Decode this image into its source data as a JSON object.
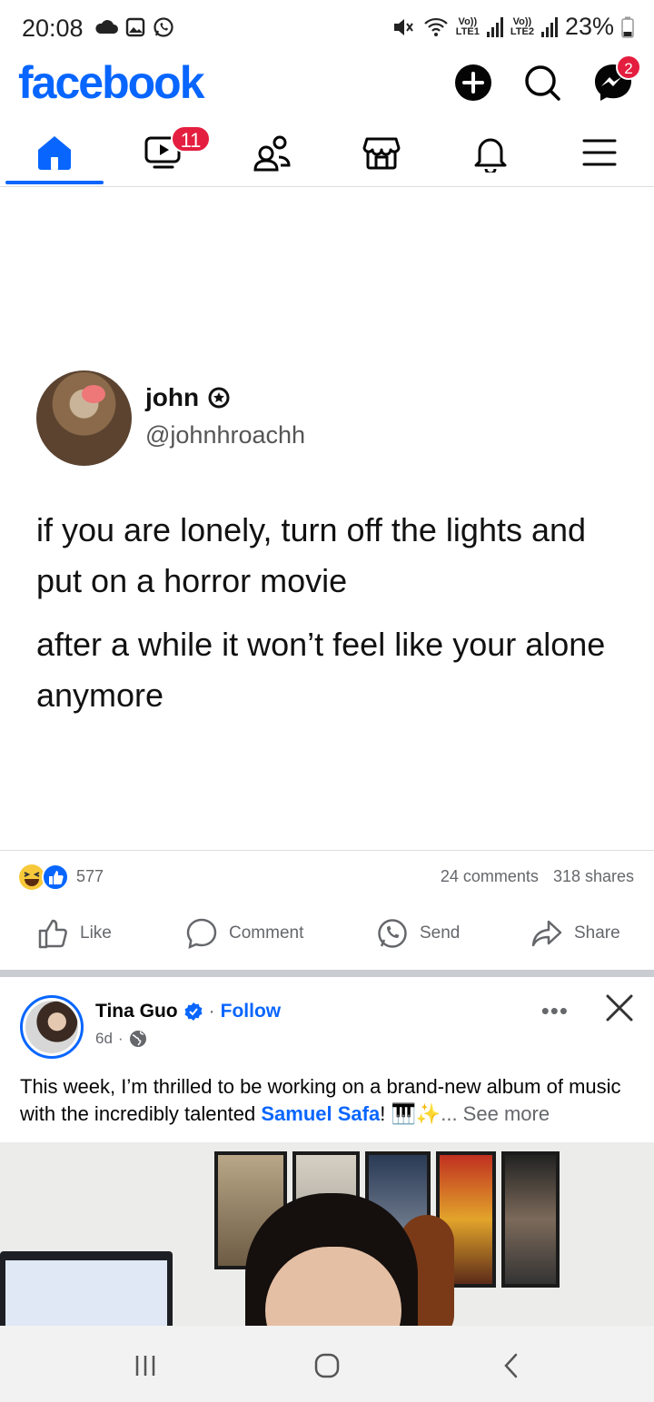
{
  "status_bar": {
    "time": "20:08",
    "battery": "23%",
    "sim1": "Vo)) LTE1",
    "sim2": "Vo)) LTE2"
  },
  "header": {
    "logo": "facebook",
    "messenger_badge": "2",
    "icons": [
      "plus-icon",
      "search-icon",
      "messenger-icon"
    ]
  },
  "nav": {
    "tabs": [
      {
        "name": "home",
        "active": true
      },
      {
        "name": "video",
        "badge": "11"
      },
      {
        "name": "friends"
      },
      {
        "name": "marketplace"
      },
      {
        "name": "notifications"
      },
      {
        "name": "menu"
      }
    ]
  },
  "post1": {
    "tweet": {
      "name": "john",
      "handle": "@johnhroachh",
      "line1": "if you are lonely, turn off the lights and put on a horror movie",
      "line2": "after a while it won’t feel like your alone anymore"
    },
    "reaction_count": "577",
    "comments": "24 comments",
    "shares": "318 shares",
    "actions": {
      "like": "Like",
      "comment": "Comment",
      "send": "Send",
      "share": "Share"
    }
  },
  "post2": {
    "author": "Tina Guo",
    "follow": "Follow",
    "time": "6d",
    "text_before": "This week, I’m thrilled to be working on a brand-new album of music with the incredibly talented ",
    "mention": "Samuel Safa",
    "text_after": "! 🎹✨",
    "see_more": "... See more",
    "more": "•••"
  },
  "colors": {
    "brand": "#0866ff",
    "badge": "#e41e3f",
    "secondary_text": "#65676b"
  }
}
